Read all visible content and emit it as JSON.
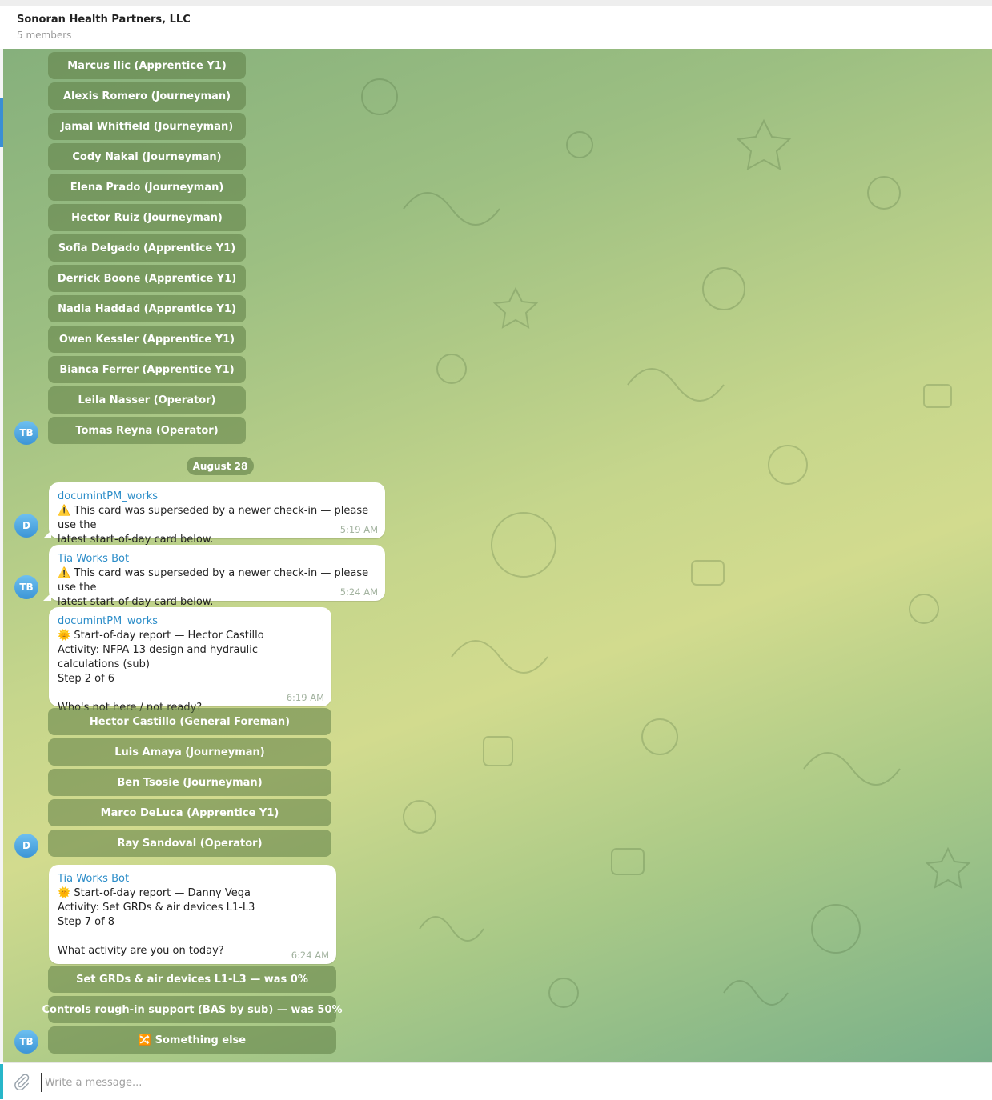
{
  "header": {
    "title": "Sonoran Health Partners, LLC",
    "subtitle": "5 members"
  },
  "keyboard_1": {
    "buttons": [
      "Marcus Ilic (Apprentice Y1)",
      "Alexis Romero (Journeyman)",
      "Jamal Whitfield (Journeyman)",
      "Cody Nakai (Journeyman)",
      "Elena Prado (Journeyman)",
      "Hector Ruiz (Journeyman)",
      "Sofia Delgado (Apprentice Y1)",
      "Derrick Boone (Apprentice Y1)",
      "Nadia Haddad (Apprentice Y1)",
      "Owen Kessler (Apprentice Y1)",
      "Bianca Ferrer (Apprentice Y1)",
      "Leila Nasser (Operator)",
      "Tomas Reyna (Operator)"
    ],
    "avatar": "TB"
  },
  "date_separator": "August 28",
  "messages": [
    {
      "sender": "documintPM_works",
      "icon": "warning-icon",
      "text": "⚠️ This card was superseded by a newer check-in — please use the\nlatest start-of-day card below.",
      "time": "5:19 AM",
      "avatar": "D"
    },
    {
      "sender": "Tia Works Bot",
      "icon": "warning-icon",
      "text": "⚠️ This card was superseded by a newer check-in — please use the\nlatest start-of-day card below.",
      "time": "5:24 AM",
      "avatar": "TB"
    },
    {
      "sender": "documintPM_works",
      "icon": "sun-icon",
      "text": "🌞 Start-of-day report — Hector Castillo\nActivity: NFPA 13 design and hydraulic calculations (sub)\nStep 2 of 6\n\nWho's not here / not ready?",
      "time": "6:19 AM",
      "avatar": "D"
    },
    {
      "sender": "Tia Works Bot",
      "icon": "sun-icon",
      "text": "🌞 Start-of-day report — Danny Vega\nActivity: Set GRDs & air devices L1-L3\nStep 7 of 8\n\nWhat activity are you on today?",
      "time": "6:24 AM",
      "avatar": "TB"
    }
  ],
  "keyboard_2": {
    "buttons": [
      "Hector Castillo (General Foreman)",
      "Luis Amaya (Journeyman)",
      "Ben Tsosie (Journeyman)",
      "Marco DeLuca (Apprentice Y1)",
      "Ray Sandoval (Operator)"
    ]
  },
  "keyboard_3": {
    "buttons": [
      "Set GRDs & air devices L1-L3 — was 0%",
      "Controls rough-in support (BAS by sub) — was 50%",
      "🔀 Something else"
    ]
  },
  "composer": {
    "placeholder": "Write a message..."
  },
  "colors": {
    "accent": "#2a8cc8",
    "avatar": "#4aa3e0",
    "button_bg": "#6e8a52"
  }
}
